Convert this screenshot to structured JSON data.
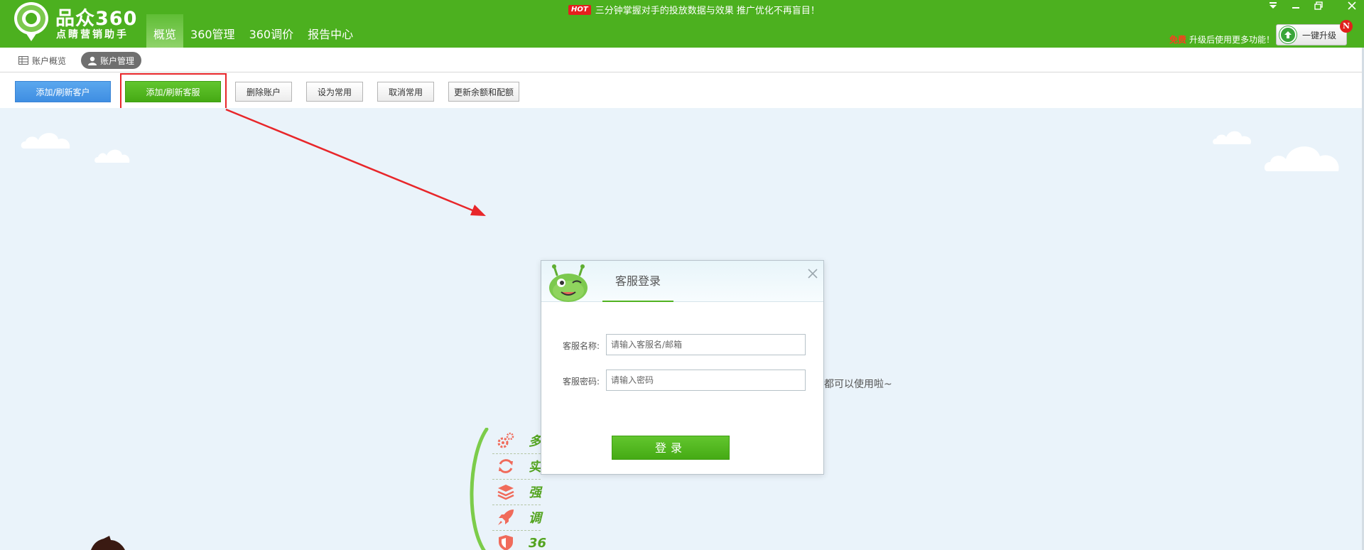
{
  "app": {
    "title": "品众360",
    "subtitle": "点睛营销助手"
  },
  "nav": {
    "tabs": [
      {
        "label": "概览",
        "active": true
      },
      {
        "label": "360管理",
        "active": false
      },
      {
        "label": "360调价",
        "active": false
      },
      {
        "label": "报告中心",
        "active": false
      }
    ]
  },
  "hot_banner": {
    "badge": "HOT",
    "text": "三分钟掌握对手的投放数据与效果  推广优化不再盲目！"
  },
  "promo": {
    "free": "免费",
    "text": "升级后使用更多功能！",
    "upgrade_label": "一键升级",
    "new_badge": "N"
  },
  "subtabs": [
    {
      "label": "账户概览",
      "icon": "grid-icon",
      "active": false
    },
    {
      "label": "账户管理",
      "icon": "user-icon",
      "active": true
    }
  ],
  "toolbar": {
    "buttons": [
      {
        "label": "添加/刷新客户",
        "style": "blue"
      },
      {
        "label": "添加/刷新客服",
        "style": "green"
      },
      {
        "label": "删除账户",
        "style": "plain"
      },
      {
        "label": "设为常用",
        "style": "plain"
      },
      {
        "label": "取消常用",
        "style": "plain"
      },
      {
        "label": "更新余额和配额",
        "style": "plain"
      }
    ]
  },
  "features": [
    {
      "text": "多",
      "icon": "gears-icon"
    },
    {
      "text": "实",
      "icon": "refresh-icon"
    },
    {
      "text": "强",
      "icon": "layers-icon"
    },
    {
      "text": "调",
      "icon": "rocket-icon"
    },
    {
      "text": "36",
      "icon": "shield-icon"
    }
  ],
  "trail_text": "都可以使用啦~",
  "dialog": {
    "title": "客服登录",
    "name_label": "客服名称:",
    "name_placeholder": "请输入客服名/邮箱",
    "password_label": "客服密码:",
    "password_placeholder": "请输入密码",
    "login_label": "登录"
  },
  "colors": {
    "brand_green": "#4cb01f",
    "button_blue": "#4a97e8",
    "highlight_red": "#e8262a",
    "content_bg": "#eaf3fa"
  }
}
